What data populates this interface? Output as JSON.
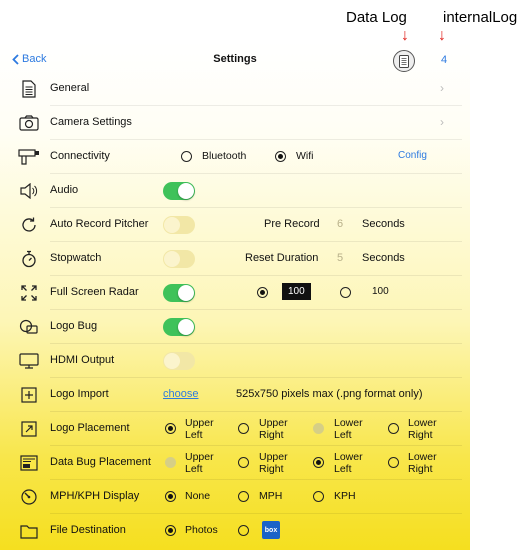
{
  "annotations": {
    "data_log": "Data Log",
    "internal_log": "internalLog",
    "arrow": "↓"
  },
  "nav": {
    "back": "Back",
    "title": "Settings",
    "log_count": "4"
  },
  "rows": {
    "general": "General",
    "camera": "Camera Settings",
    "connectivity": {
      "label": "Connectivity",
      "opt1": "Bluetooth",
      "opt2": "Wifi",
      "config": "Config",
      "selected": "Wifi"
    },
    "audio": {
      "label": "Audio",
      "on": true
    },
    "auto_record": {
      "label": "Auto Record Pitcher",
      "on": false,
      "pre_label": "Pre Record",
      "pre_value": "6",
      "unit": "Seconds"
    },
    "stopwatch": {
      "label": "Stopwatch",
      "on": false,
      "reset_label": "Reset Duration",
      "reset_value": "5",
      "unit": "Seconds"
    },
    "radar": {
      "label": "Full Screen Radar",
      "on": true,
      "opt1": "100",
      "opt2": "100",
      "selected": "opt1"
    },
    "logo_bug": {
      "label": "Logo Bug",
      "on": true
    },
    "hdmi": {
      "label": "HDMI Output",
      "on": false
    },
    "logo_import": {
      "label": "Logo Import",
      "link": "choose",
      "hint": "525x750 pixels max (.png format only)"
    },
    "logo_placement": {
      "label": "Logo Placement",
      "opts": [
        "Upper\nLeft",
        "Upper\nRight",
        "Lower\nLeft",
        "Lower\nRight"
      ],
      "selected": 0,
      "disabled": 2
    },
    "data_bug": {
      "label": "Data Bug Placement",
      "opts": [
        "Upper\nLeft",
        "Upper\nRight",
        "Lower\nLeft",
        "Lower\nRight"
      ],
      "selected": 2,
      "disabled": 0
    },
    "speed": {
      "label": "MPH/KPH Display",
      "opt1": "None",
      "opt2": "MPH",
      "opt3": "KPH",
      "selected": "None"
    },
    "file_dest": {
      "label": "File Destination",
      "opt1": "Photos",
      "logo": "box",
      "selected": "Photos"
    }
  },
  "colors": {
    "accent": "#2d7ae0",
    "toggle_on": "#3fc25a",
    "annotation_arrow": "#e0201b"
  }
}
